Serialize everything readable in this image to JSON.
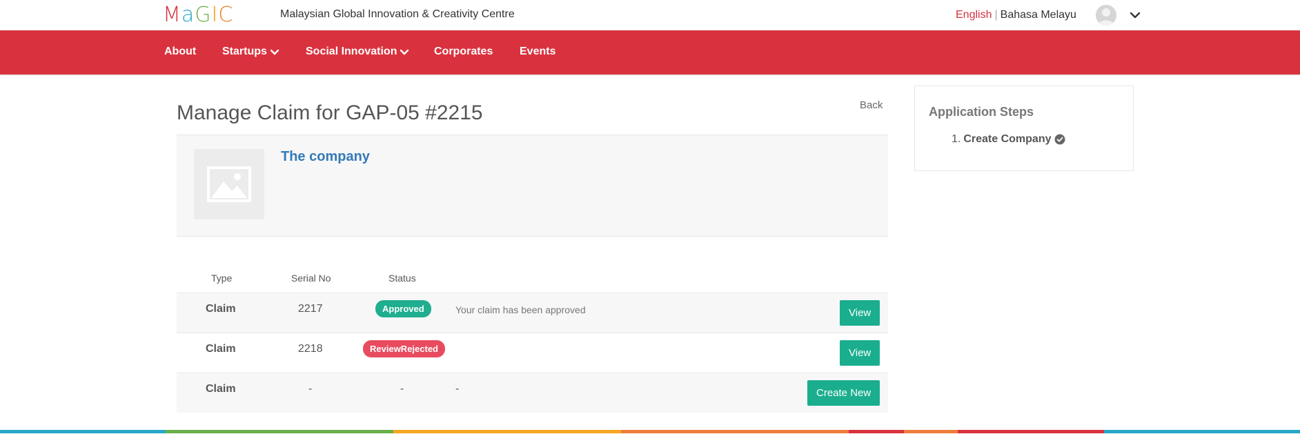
{
  "header": {
    "logo_text": "MaGIC",
    "org_name": "Malaysian Global Innovation & Creativity Centre",
    "lang_english": "English",
    "lang_separator": "|",
    "lang_malay": "Bahasa Melayu"
  },
  "nav": {
    "items": [
      {
        "label": "About"
      },
      {
        "label": "Startups"
      },
      {
        "label": "Social Innovation"
      },
      {
        "label": "Corporates"
      },
      {
        "label": "Events"
      }
    ]
  },
  "main": {
    "title": "Manage Claim for GAP-05 #2215",
    "back_label": "Back",
    "company_name": "The company",
    "table": {
      "headers": [
        "Type",
        "Serial No",
        "Status"
      ],
      "rows": [
        {
          "type": "Claim",
          "serial": "2217",
          "status": "Approved",
          "note": "Your claim has been approved",
          "action": "View"
        },
        {
          "type": "Claim",
          "serial": "2218",
          "status": "ReviewRejected",
          "note": "",
          "action": "View"
        },
        {
          "type": "Claim",
          "serial": "-",
          "status": "-",
          "note": "-",
          "action": "Create New"
        }
      ]
    }
  },
  "side": {
    "title": "Application Steps",
    "steps": [
      {
        "num": "1.",
        "label": "Create Company"
      }
    ]
  },
  "colors": {
    "brand_red": "#d9323e",
    "action_green": "#1aae8e",
    "approved": "#1fae8f",
    "rejected": "#e84b5f",
    "link_blue": "#337ab7"
  }
}
